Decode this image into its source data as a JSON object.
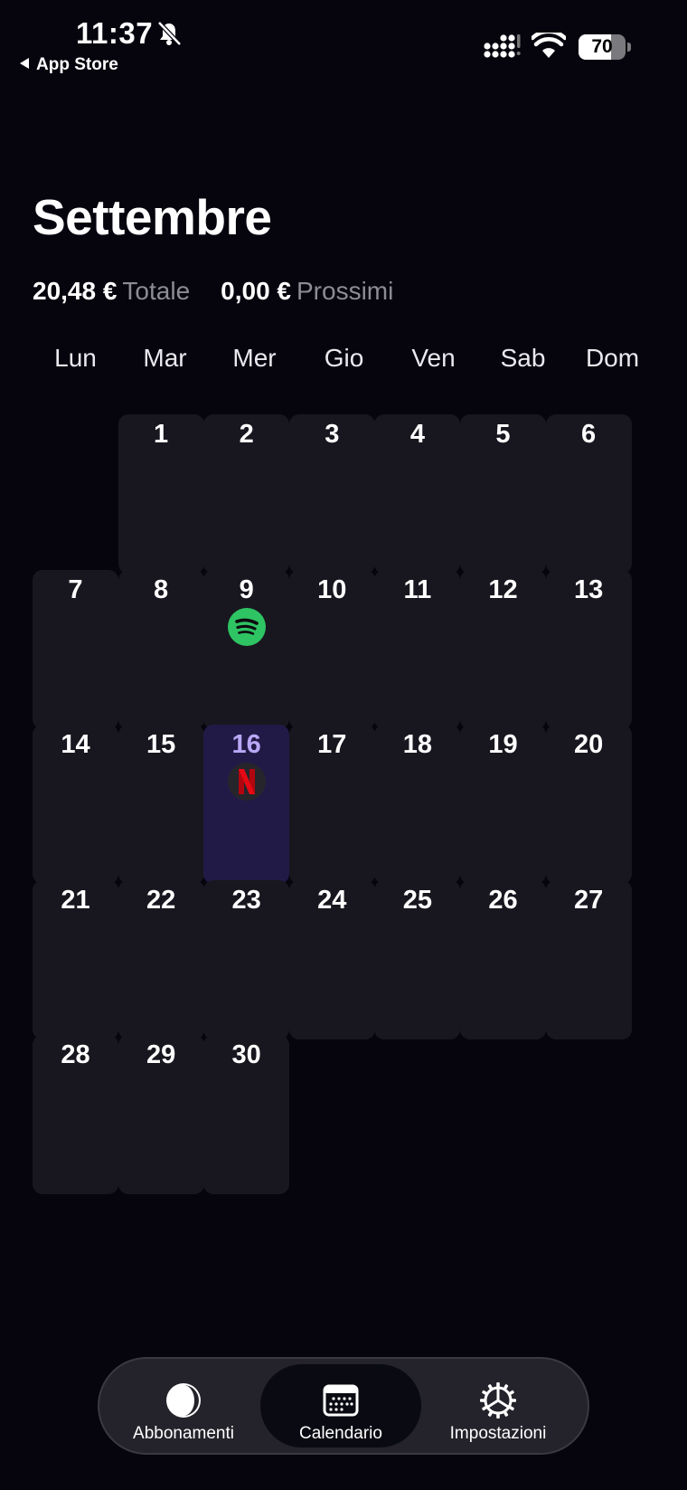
{
  "status_bar": {
    "time": "11:37",
    "back_label": "App Store",
    "battery": "70",
    "battery_level_percent": 70
  },
  "header": {
    "month_title": "Settembre",
    "total_amount": "20,48 €",
    "total_label": "Totale",
    "upcoming_amount": "0,00 €",
    "upcoming_label": "Prossimi"
  },
  "weekdays": [
    "Lun",
    "Mar",
    "Mer",
    "Gio",
    "Ven",
    "Sab",
    "Dom"
  ],
  "calendar": {
    "days": [
      "1",
      "2",
      "3",
      "4",
      "5",
      "6",
      "7",
      "8",
      "9",
      "10",
      "11",
      "12",
      "13",
      "14",
      "15",
      "16",
      "17",
      "18",
      "19",
      "20",
      "21",
      "22",
      "23",
      "24",
      "25",
      "26",
      "27",
      "28",
      "29",
      "30"
    ],
    "today": "16",
    "subscriptions": [
      {
        "day": "9",
        "icon": "spotify-icon",
        "color": "#2ec463"
      },
      {
        "day": "16",
        "icon": "netflix-icon",
        "color": "#e50914"
      }
    ]
  },
  "tab_bar": {
    "tabs": [
      {
        "label": "Abbonamenti",
        "icon": "half-circle-icon"
      },
      {
        "label": "Calendario",
        "icon": "calendar-icon"
      },
      {
        "label": "Impostazioni",
        "icon": "gear-icon"
      }
    ],
    "active": "Calendario"
  },
  "colors": {
    "background": "#06050e",
    "cell": "#18171f",
    "today_cell": "#221a46",
    "today_text": "#b8a8f6",
    "muted_text": "#8c8c96"
  }
}
